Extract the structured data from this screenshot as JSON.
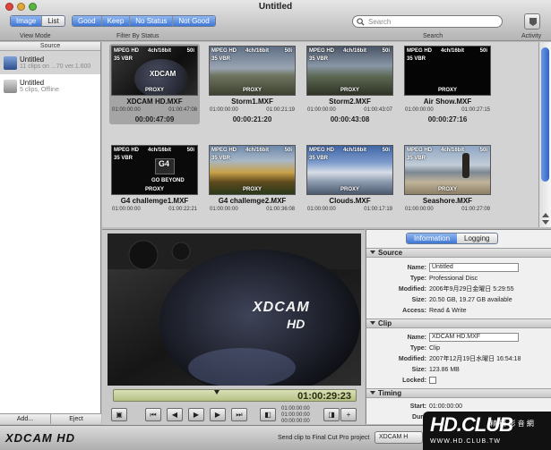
{
  "window": {
    "title": "Untitled"
  },
  "toolbar": {
    "view_mode": {
      "label": "View Mode",
      "options": [
        "Image",
        "List"
      ],
      "selected": "Image"
    },
    "filter": {
      "label": "Filter By Status",
      "options": [
        "Good",
        "Keep",
        "No Status",
        "Not Good"
      ]
    },
    "search": {
      "label": "Search",
      "placeholder": "Search"
    },
    "activity_label": "Activity"
  },
  "sidebar": {
    "header": "Source",
    "sources": [
      {
        "name": "Untitled",
        "subtitle": "11 clips on ...70 ver.1.600",
        "selected": true
      },
      {
        "name": "Untitled",
        "subtitle": "5 clips, Offline",
        "selected": false
      }
    ],
    "add_label": "Add...",
    "eject_label": "Eject"
  },
  "clips": [
    {
      "name": "XDCAM HD.MXF",
      "format": "MPEG HD",
      "audio": "4ch/16bit",
      "rate": "50i",
      "bitrate": "35 VBR",
      "proxy": "PROXY",
      "in": "01:00:00:00",
      "out": "01:00:47:08",
      "duration": "00:00:47:09",
      "thumb_text": "XDCAM",
      "selected": true
    },
    {
      "name": "Storm1.MXF",
      "format": "MPEG HD",
      "audio": "4ch/16bit",
      "rate": "50i",
      "bitrate": "35 VBR",
      "proxy": "PROXY",
      "in": "01:00:00:00",
      "out": "01:00:21:19",
      "duration": "00:00:21:20",
      "thumb_text": "",
      "selected": false
    },
    {
      "name": "Storm2.MXF",
      "format": "MPEG HD",
      "audio": "4ch/16bit",
      "rate": "50i",
      "bitrate": "35 VBR",
      "proxy": "PROXY",
      "in": "01:00:00:00",
      "out": "01:00:43:07",
      "duration": "00:00:43:08",
      "thumb_text": "",
      "selected": false
    },
    {
      "name": "Air Show.MXF",
      "format": "MPEG HD",
      "audio": "4ch/16bit",
      "rate": "50i",
      "bitrate": "35 VBR",
      "proxy": "PROXY",
      "in": "01:00:00:00",
      "out": "01:00:27:15",
      "duration": "00:00:27:16",
      "thumb_text": "",
      "selected": false
    },
    {
      "name": "G4 challemge1.MXF",
      "format": "MPEG HD",
      "audio": "4ch/16bit",
      "rate": "50i",
      "bitrate": "35 VBR",
      "proxy": "PROXY",
      "in": "01:00:00:00",
      "out": "01:00:22:21",
      "duration": "",
      "thumb_text": "G4",
      "thumb_text2": "GO BEYOND",
      "selected": false
    },
    {
      "name": "G4 challemge2.MXF",
      "format": "MPEG HD",
      "audio": "4ch/16bit",
      "rate": "50i",
      "bitrate": "35 VBR",
      "proxy": "PROXY",
      "in": "01:00:00:00",
      "out": "01:00:36:08",
      "duration": "",
      "thumb_text": "",
      "selected": false
    },
    {
      "name": "Clouds.MXF",
      "format": "MPEG HD",
      "audio": "4ch/16bit",
      "rate": "50i",
      "bitrate": "35 VBR",
      "proxy": "PROXY",
      "in": "01:00:00:00",
      "out": "01:00:17:19",
      "duration": "",
      "thumb_text": "",
      "selected": false
    },
    {
      "name": "Seashore.MXF",
      "format": "MPEG HD",
      "audio": "4ch/16bit",
      "rate": "50i",
      "bitrate": "35 VBR",
      "proxy": "PROXY",
      "in": "01:00:00:00",
      "out": "01:00:27:09",
      "duration": "",
      "thumb_text": "",
      "selected": false
    }
  ],
  "player": {
    "video_text": "XDCAM",
    "video_text2": "HD",
    "timecode": "01:00:29:23",
    "playhead_fraction": 0.62,
    "tc_in": "01:00:00:00",
    "tc_out": "01:00:00:00",
    "tc_dur": "00:00:00:00"
  },
  "info": {
    "tabs": [
      "Information",
      "Logging"
    ],
    "selected_tab": "Information",
    "source": {
      "title": "Source",
      "name_label": "Name:",
      "name": "Untitled",
      "type_label": "Type:",
      "type": "Professional Disc",
      "modified_label": "Modified:",
      "modified": "2006年9月29日金曜日 5:29:55",
      "size_label": "Size:",
      "size": "20.50 GB, 19.27 GB available",
      "access_label": "Access:",
      "access": "Read & Write"
    },
    "clip": {
      "title": "Clip",
      "name_label": "Name:",
      "name": "XDCAM HD.MXF",
      "type_label": "Type:",
      "type": "Clip",
      "modified_label": "Modified:",
      "modified": "2007年12月19日水曜日 16:54:18",
      "size_label": "Size:",
      "size": "123.86 MB",
      "locked_label": "Locked:"
    },
    "timing": {
      "title": "Timing",
      "start_label": "Start:",
      "start": "01:00:00:00",
      "dur_label": "Dura"
    }
  },
  "bottom": {
    "brand": "XDCAM HD",
    "send_label": "Send clip to Final Cut Pro project",
    "send_value": "XDCAM H"
  },
  "watermark": {
    "logo": "HD.CLUB",
    "cn": "精 研 影 音 網",
    "url": "WWW.HD.CLUB.TW"
  },
  "colors": {
    "accent": "#3f78d6",
    "timebar": "#c6cf9b"
  }
}
